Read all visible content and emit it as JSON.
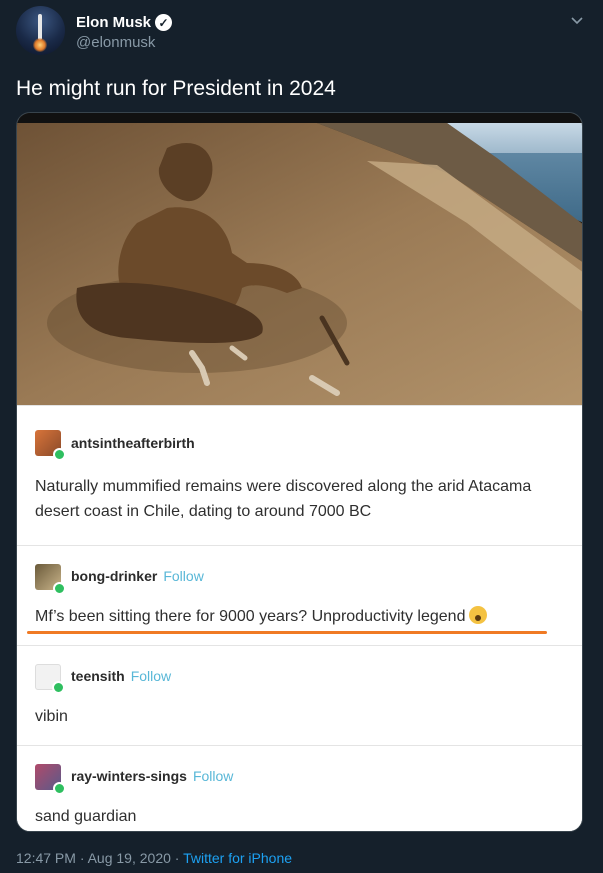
{
  "author": {
    "name": "Elon Musk",
    "handle": "@elonmusk",
    "verified_icon": "verified-badge-icon"
  },
  "tweet": {
    "text": "He might run for President in 2024",
    "timestamp": "12:47 PM · Aug 19, 2020 · ",
    "source": "Twitter for iPhone"
  },
  "posts": [
    {
      "username": "antsintheafterbirth",
      "follow": "",
      "text": "Naturally mummified remains were discovered along the arid Atacama desert coast in Chile, dating to around 7000 BC"
    },
    {
      "username": "bong-drinker",
      "follow": "Follow",
      "text": "Mf’s been sitting there for 9000 years? Unproductivity legend"
    },
    {
      "username": "teensith",
      "follow": "Follow",
      "text": "vibin"
    },
    {
      "username": "ray-winters-sings",
      "follow": "Follow",
      "text": "sand guardian"
    }
  ],
  "colors": {
    "background": "#15202b",
    "secondary_text": "#8899a6",
    "link": "#1da1f2",
    "follow": "#58b7d7",
    "highlight_underline": "#f07a24"
  }
}
